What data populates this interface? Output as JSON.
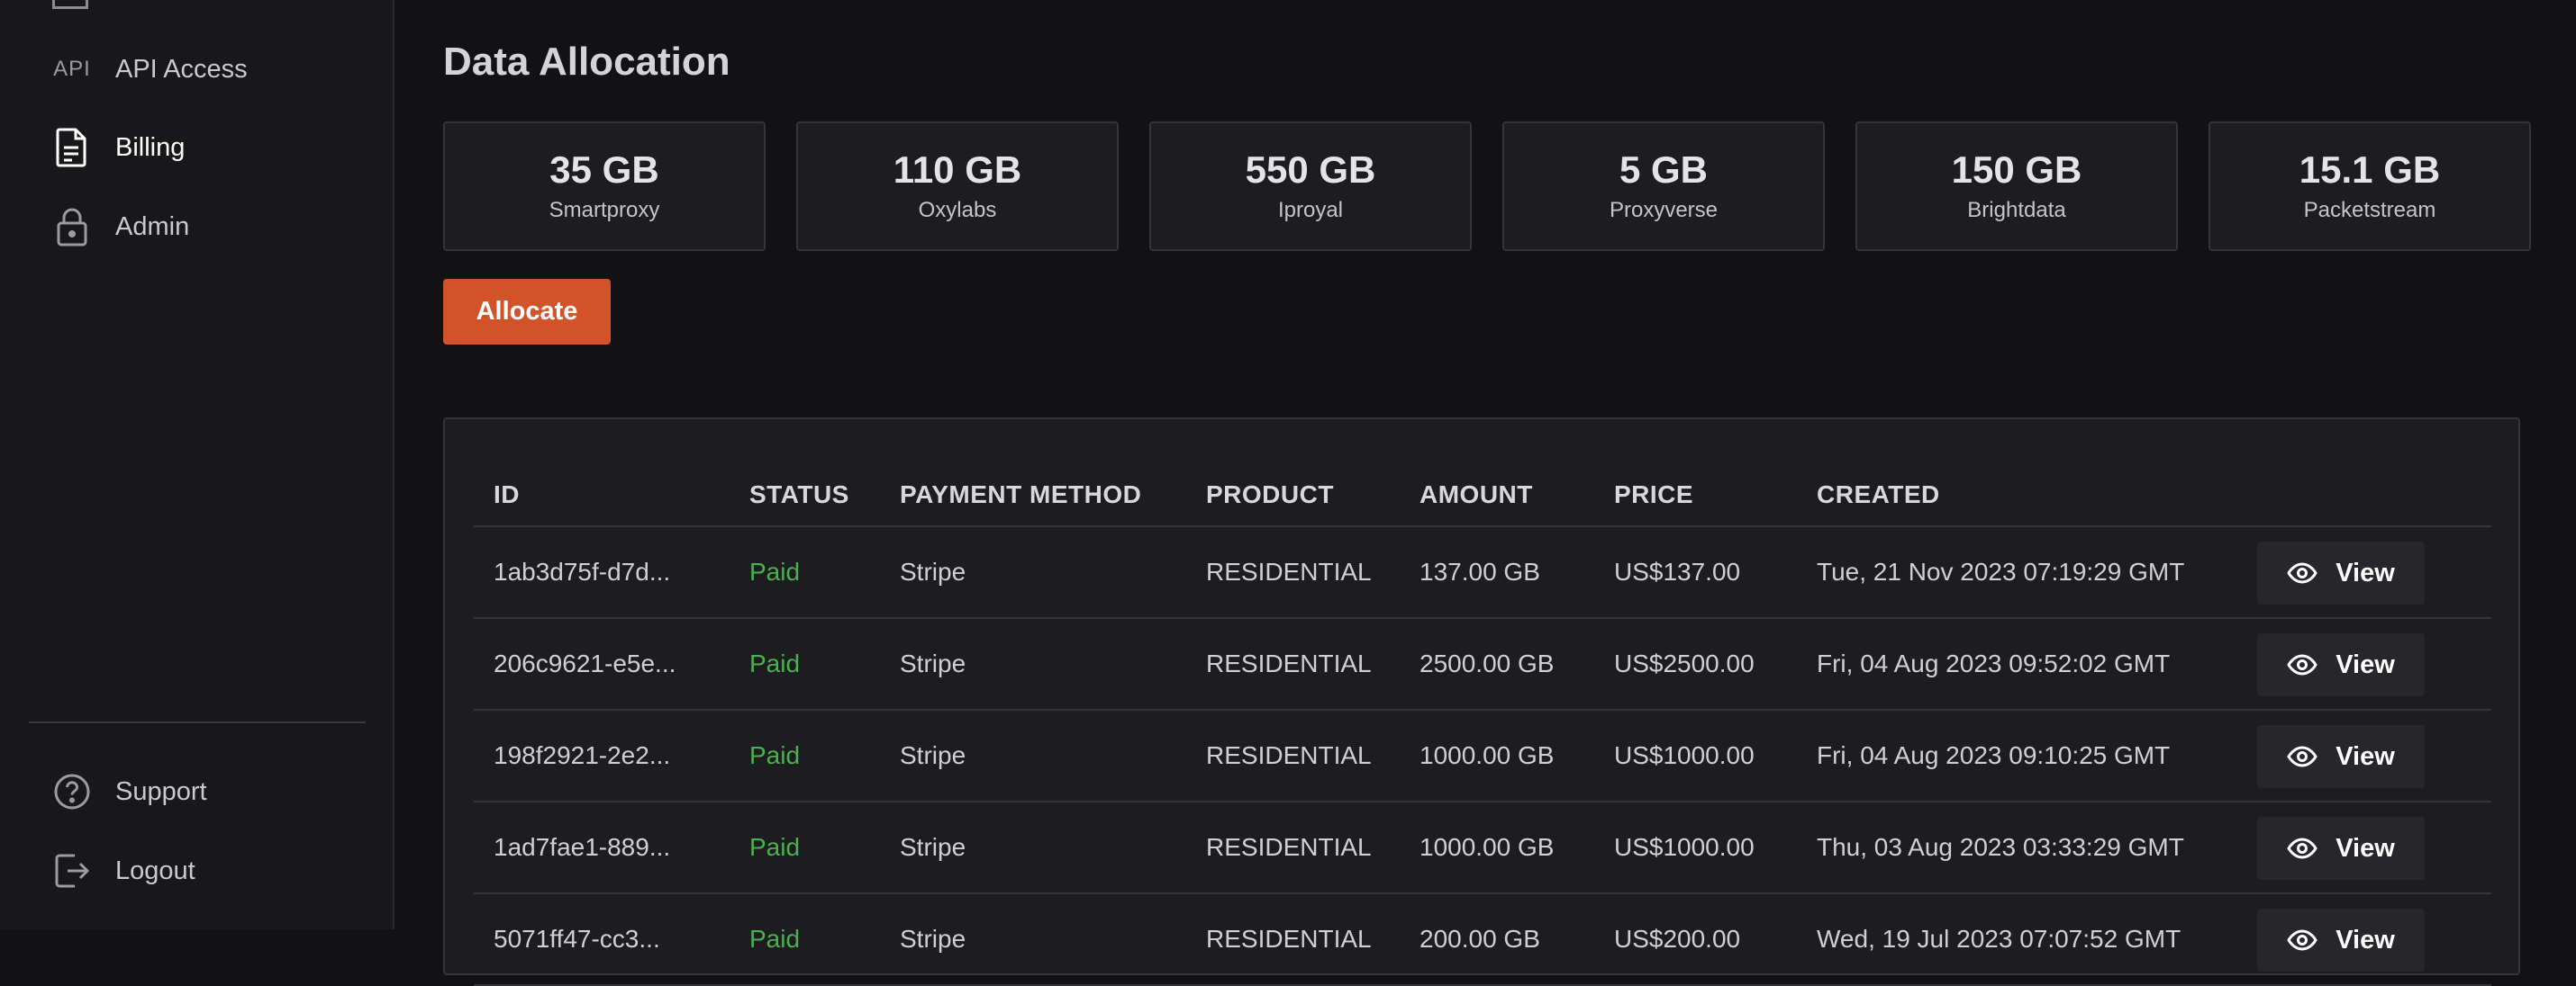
{
  "sidebar": {
    "items": [
      {
        "label": "API Access",
        "icon": "api-icon",
        "active": false
      },
      {
        "label": "Billing",
        "icon": "document-icon",
        "active": true
      },
      {
        "label": "Admin",
        "icon": "lock-icon",
        "active": false
      }
    ],
    "api_glyph": "API",
    "footer_items": [
      {
        "label": "Support",
        "icon": "help-circle-icon"
      },
      {
        "label": "Logout",
        "icon": "logout-icon"
      }
    ]
  },
  "main": {
    "title": "Data Allocation",
    "allocations": [
      {
        "amount": "35 GB",
        "provider": "Smartproxy"
      },
      {
        "amount": "110 GB",
        "provider": "Oxylabs"
      },
      {
        "amount": "550 GB",
        "provider": "Iproyal"
      },
      {
        "amount": "5 GB",
        "provider": "Proxyverse"
      },
      {
        "amount": "150 GB",
        "provider": "Brightdata"
      },
      {
        "amount": "15.1 GB",
        "provider": "Packetstream"
      }
    ],
    "allocate_label": "Allocate"
  },
  "table": {
    "columns": [
      "ID",
      "STATUS",
      "PAYMENT METHOD",
      "PRODUCT",
      "AMOUNT",
      "PRICE",
      "CREATED"
    ],
    "view_label": "View",
    "rows": [
      {
        "id": "1ab3d75f-d7d...",
        "status": "Paid",
        "method": "Stripe",
        "product": "RESIDENTIAL",
        "amount": "137.00 GB",
        "price": "US$137.00",
        "created": "Tue, 21 Nov 2023 07:19:29 GMT"
      },
      {
        "id": "206c9621-e5e...",
        "status": "Paid",
        "method": "Stripe",
        "product": "RESIDENTIAL",
        "amount": "2500.00 GB",
        "price": "US$2500.00",
        "created": "Fri, 04 Aug 2023 09:52:02 GMT"
      },
      {
        "id": "198f2921-2e2...",
        "status": "Paid",
        "method": "Stripe",
        "product": "RESIDENTIAL",
        "amount": "1000.00 GB",
        "price": "US$1000.00",
        "created": "Fri, 04 Aug 2023 09:10:25 GMT"
      },
      {
        "id": "1ad7fae1-889...",
        "status": "Paid",
        "method": "Stripe",
        "product": "RESIDENTIAL",
        "amount": "1000.00 GB",
        "price": "US$1000.00",
        "created": "Thu, 03 Aug 2023 03:33:29 GMT"
      },
      {
        "id": "5071ff47-cc3...",
        "status": "Paid",
        "method": "Stripe",
        "product": "RESIDENTIAL",
        "amount": "200.00 GB",
        "price": "US$200.00",
        "created": "Wed, 19 Jul 2023 07:07:52 GMT"
      }
    ]
  },
  "colors": {
    "accent": "#d2532a",
    "status_paid": "#4caf50",
    "background": "#121214",
    "panel": "#1d1d21"
  }
}
